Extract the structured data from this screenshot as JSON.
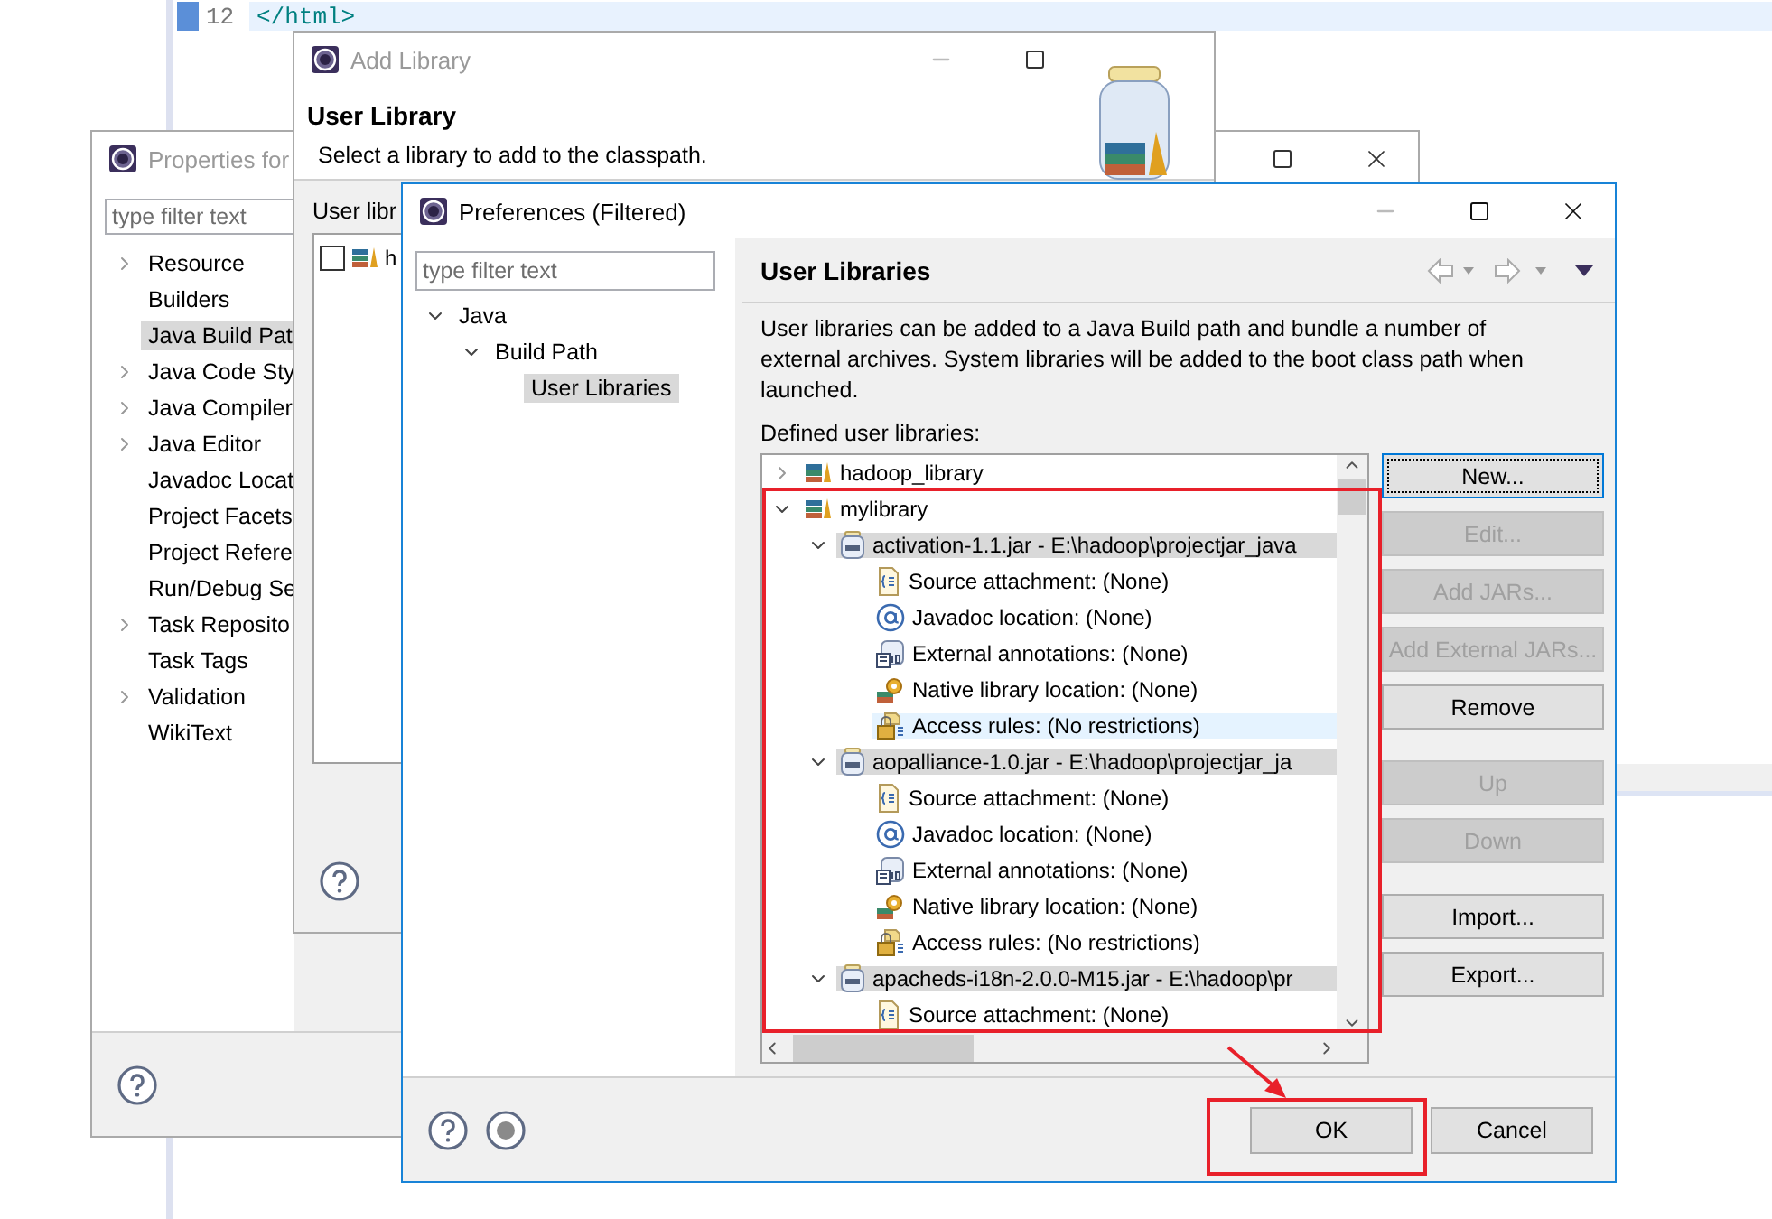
{
  "editor": {
    "lines": [
      {
        "number": "12",
        "code": "</html>",
        "current": true
      }
    ]
  },
  "properties_window": {
    "title": "Properties for",
    "filter": {
      "placeholder": "type filter text"
    },
    "tree": [
      {
        "label": "Resource",
        "expandable": true,
        "selected": false
      },
      {
        "label": "Builders",
        "expandable": false,
        "selected": false
      },
      {
        "label": "Java Build Pat",
        "expandable": false,
        "selected": true
      },
      {
        "label": "Java Code Sty",
        "expandable": true,
        "selected": false
      },
      {
        "label": "Java Compiler",
        "expandable": true,
        "selected": false
      },
      {
        "label": "Java Editor",
        "expandable": true,
        "selected": false
      },
      {
        "label": "Javadoc Locat",
        "expandable": false,
        "selected": false
      },
      {
        "label": "Project Facets",
        "expandable": false,
        "selected": false
      },
      {
        "label": "Project Refere",
        "expandable": false,
        "selected": false
      },
      {
        "label": "Run/Debug Se",
        "expandable": false,
        "selected": false
      },
      {
        "label": "Task Reposito",
        "expandable": true,
        "selected": false
      },
      {
        "label": "Task Tags",
        "expandable": false,
        "selected": false
      },
      {
        "label": "Validation",
        "expandable": true,
        "selected": false
      },
      {
        "label": "WikiText",
        "expandable": false,
        "selected": false
      }
    ]
  },
  "add_library_window": {
    "title": "Add Library",
    "heading": "User Library",
    "description": "Select a library to add to the classpath.",
    "list_label": "User libr",
    "libraries": [
      {
        "label": "h",
        "checked": false
      }
    ]
  },
  "preferences_window": {
    "title": "Preferences (Filtered)",
    "filter": {
      "placeholder": "type filter text"
    },
    "nav_tree": [
      {
        "label": "Java",
        "expanded": true,
        "selected": false,
        "children": [
          {
            "label": "Build Path",
            "expanded": true,
            "selected": false,
            "children": [
              {
                "label": "User Libraries",
                "selected": true
              }
            ]
          }
        ]
      }
    ],
    "page_title": "User Libraries",
    "description": "User libraries can be added to a Java Build path and bundle a number of external archives. System libraries will be added to the boot class path when launched.",
    "list_label": "Defined user libraries:",
    "libraries": [
      {
        "kind": "library",
        "label": "hadoop_library",
        "expanded": false,
        "selected": false
      },
      {
        "kind": "library",
        "label": "mylibrary",
        "expanded": true,
        "selected": false,
        "children": [
          {
            "kind": "jar",
            "label": "activation-1.1.jar - E:\\hadoop\\projectjar_java",
            "expanded": true,
            "selected": true,
            "children": [
              {
                "kind": "source",
                "label": "Source attachment: (None)",
                "selected": false
              },
              {
                "kind": "javadoc",
                "label": "Javadoc location: (None)",
                "selected": false
              },
              {
                "kind": "annotations",
                "label": "External annotations: (None)",
                "selected": false
              },
              {
                "kind": "native",
                "label": "Native library location: (None)",
                "selected": false
              },
              {
                "kind": "access",
                "label": "Access rules: (No restrictions)",
                "selected": false,
                "hovered": true
              }
            ]
          },
          {
            "kind": "jar",
            "label": "aopalliance-1.0.jar - E:\\hadoop\\projectjar_ja",
            "expanded": true,
            "selected": true,
            "children": [
              {
                "kind": "source",
                "label": "Source attachment: (None)",
                "selected": false
              },
              {
                "kind": "javadoc",
                "label": "Javadoc location: (None)",
                "selected": false
              },
              {
                "kind": "annotations",
                "label": "External annotations: (None)",
                "selected": false
              },
              {
                "kind": "native",
                "label": "Native library location: (None)",
                "selected": false
              },
              {
                "kind": "access",
                "label": "Access rules: (No restrictions)",
                "selected": false
              }
            ]
          },
          {
            "kind": "jar",
            "label": "apacheds-i18n-2.0.0-M15.jar - E:\\hadoop\\pr",
            "expanded": true,
            "selected": true,
            "children": [
              {
                "kind": "source",
                "label": "Source attachment: (None)",
                "selected": false
              }
            ]
          }
        ]
      }
    ],
    "button_groups": [
      [
        {
          "label": "New...",
          "disabled": false,
          "focused": true
        },
        {
          "label": "Edit...",
          "disabled": true,
          "focused": false
        },
        {
          "label": "Add JARs...",
          "disabled": true,
          "focused": false
        },
        {
          "label": "Add External JARs...",
          "disabled": true,
          "focused": false
        },
        {
          "label": "Remove",
          "disabled": false,
          "focused": false
        }
      ],
      [
        {
          "label": "Up",
          "disabled": true,
          "focused": false
        },
        {
          "label": "Down",
          "disabled": true,
          "focused": false
        }
      ],
      [
        {
          "label": "Import...",
          "disabled": false,
          "focused": false
        },
        {
          "label": "Export...",
          "disabled": false,
          "focused": false
        }
      ]
    ],
    "footer_buttons": [
      {
        "label": "OK",
        "highlighted": true
      },
      {
        "label": "Cancel",
        "highlighted": false
      }
    ]
  }
}
